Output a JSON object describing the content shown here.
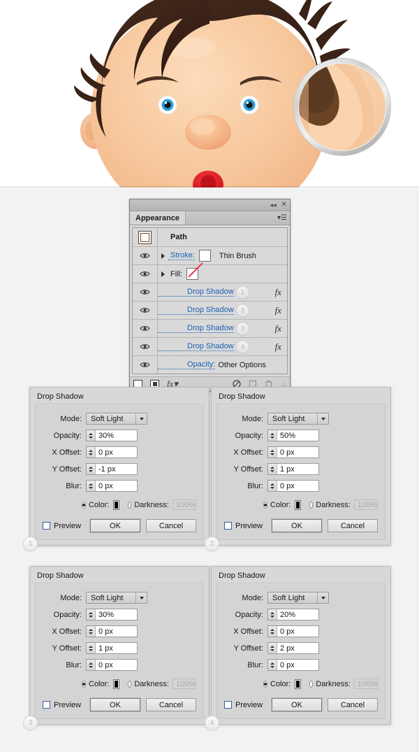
{
  "illustration": {
    "alt_name": "cartoon-boy-face-with-ear-zoom-callout",
    "colors": {
      "hair_dark": "#3b2419",
      "hair_mid": "#5a3a26",
      "skin": "#f6c79a",
      "skin_light": "#fbdcbc",
      "skin_shadow": "#e9a877",
      "nose": "#f5b98a",
      "mouth_red": "#e0252a",
      "eye_blue": "#2b9fd4",
      "eye_white": "#ffffff",
      "brow": "#4a3122",
      "loupe_ring": "#d8d8d8"
    }
  },
  "appearance_panel": {
    "titlebar": {
      "collapse_icon": "collapse-double-arrow-icon",
      "close_icon": "close-icon"
    },
    "tab_label": "Appearance",
    "menu_icon": "panel-menu-icon",
    "path_row": {
      "label": "Path",
      "thumbnail": "path-thumbnail-icon"
    },
    "rows": [
      {
        "type": "stroke",
        "eye": "visibility-eye-icon",
        "disclosure": "disclosure-triangle-icon",
        "label": "Stroke:",
        "swatch_color": "#6b3f1d",
        "value": "Thin Brush"
      },
      {
        "type": "fill",
        "eye": "visibility-eye-icon",
        "disclosure": "disclosure-triangle-icon",
        "label": "Fill:",
        "swatch_color": "none",
        "value": ""
      },
      {
        "type": "effect",
        "eye": "visibility-eye-icon",
        "label": "Drop Shadow",
        "badge": "1",
        "fx": "fx"
      },
      {
        "type": "effect",
        "eye": "visibility-eye-icon",
        "label": "Drop Shadow",
        "badge": "2",
        "fx": "fx"
      },
      {
        "type": "effect",
        "eye": "visibility-eye-icon",
        "label": "Drop Shadow",
        "badge": "3",
        "fx": "fx"
      },
      {
        "type": "effect",
        "eye": "visibility-eye-icon",
        "label": "Drop Shadow",
        "badge": "4",
        "fx": "fx"
      },
      {
        "type": "opacity",
        "eye": "visibility-eye-icon",
        "label": "Opacity:",
        "value": "Other Options"
      }
    ],
    "footer_icons": [
      "add-new-stroke-icon",
      "add-new-fill-icon",
      "add-new-effect-icon",
      "clear-appearance-icon",
      "duplicate-item-icon",
      "delete-item-icon",
      "resize-grip-icon"
    ]
  },
  "dialogs": [
    {
      "badge": "1",
      "title": "Drop Shadow",
      "mode_label": "Mode:",
      "mode_value": "Soft Light",
      "opacity_label": "Opacity:",
      "opacity_value": "30%",
      "xoffset_label": "X Offset:",
      "xoffset_value": "0 px",
      "yoffset_label": "Y Offset:",
      "yoffset_value": "-1 px",
      "blur_label": "Blur:",
      "blur_value": "0 px",
      "color_label": "Color:",
      "color_value": "#000000",
      "darkness_label": "Darkness:",
      "darkness_value": "100%",
      "preview_label": "Preview",
      "ok_label": "OK",
      "cancel_label": "Cancel"
    },
    {
      "badge": "2",
      "title": "Drop Shadow",
      "mode_label": "Mode:",
      "mode_value": "Soft Light",
      "opacity_label": "Opacity:",
      "opacity_value": "50%",
      "xoffset_label": "X Offset:",
      "xoffset_value": "0 px",
      "yoffset_label": "Y Offset:",
      "yoffset_value": "1 px",
      "blur_label": "Blur:",
      "blur_value": "0 px",
      "color_label": "Color:",
      "color_value": "#000000",
      "darkness_label": "Darkness:",
      "darkness_value": "100%",
      "preview_label": "Preview",
      "ok_label": "OK",
      "cancel_label": "Cancel"
    },
    {
      "badge": "3",
      "title": "Drop Shadow",
      "mode_label": "Mode:",
      "mode_value": "Soft Light",
      "opacity_label": "Opacity:",
      "opacity_value": "30%",
      "xoffset_label": "X Offset:",
      "xoffset_value": "0 px",
      "yoffset_label": "Y Offset:",
      "yoffset_value": "1 px",
      "blur_label": "Blur:",
      "blur_value": "0 px",
      "color_label": "Color:",
      "color_value": "#000000",
      "darkness_label": "Darkness:",
      "darkness_value": "100%",
      "preview_label": "Preview",
      "ok_label": "OK",
      "cancel_label": "Cancel"
    },
    {
      "badge": "4",
      "title": "Drop Shadow",
      "mode_label": "Mode:",
      "mode_value": "Soft Light",
      "opacity_label": "Opacity:",
      "opacity_value": "20%",
      "xoffset_label": "X Offset:",
      "xoffset_value": "0 px",
      "yoffset_label": "Y Offset:",
      "yoffset_value": "2 px",
      "blur_label": "Blur:",
      "blur_value": "0 px",
      "color_label": "Color:",
      "color_value": "#000000",
      "darkness_label": "Darkness:",
      "darkness_value": "100%",
      "preview_label": "Preview",
      "ok_label": "OK",
      "cancel_label": "Cancel"
    }
  ]
}
